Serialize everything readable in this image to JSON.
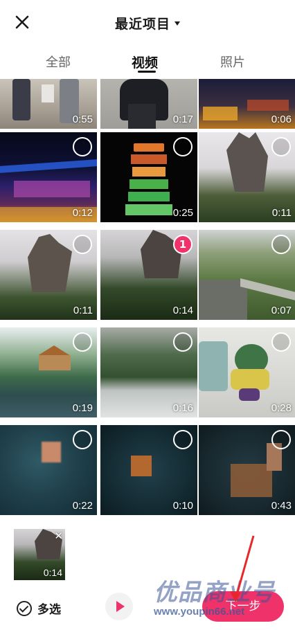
{
  "header": {
    "title": "最近项目"
  },
  "tabs": [
    {
      "label": "全部",
      "active": false
    },
    {
      "label": "视频",
      "active": true
    },
    {
      "label": "照片",
      "active": false
    }
  ],
  "grid": [
    {
      "duration": "0:55",
      "selected": false
    },
    {
      "duration": "0:17",
      "selected": false
    },
    {
      "duration": "0:06",
      "selected": false
    },
    {
      "duration": "0:12",
      "selected": false
    },
    {
      "duration": "0:25",
      "selected": false
    },
    {
      "duration": "0:11",
      "selected": false
    },
    {
      "duration": "0:11",
      "selected": false
    },
    {
      "duration": "0:14",
      "selected": true,
      "selection_index": "1"
    },
    {
      "duration": "0:07",
      "selected": false
    },
    {
      "duration": "0:19",
      "selected": false
    },
    {
      "duration": "0:16",
      "selected": false
    },
    {
      "duration": "0:28",
      "selected": false
    },
    {
      "duration": "0:22",
      "selected": false
    },
    {
      "duration": "0:10",
      "selected": false
    },
    {
      "duration": "0:43",
      "selected": false
    }
  ],
  "bottom": {
    "selected_thumb_duration": "0:14",
    "multi_select_label": "多选",
    "next_label": "下一步"
  },
  "watermark": {
    "text": "优品商业号",
    "url": "www.youpin66.net"
  },
  "colors": {
    "accent": "#f0326a"
  }
}
